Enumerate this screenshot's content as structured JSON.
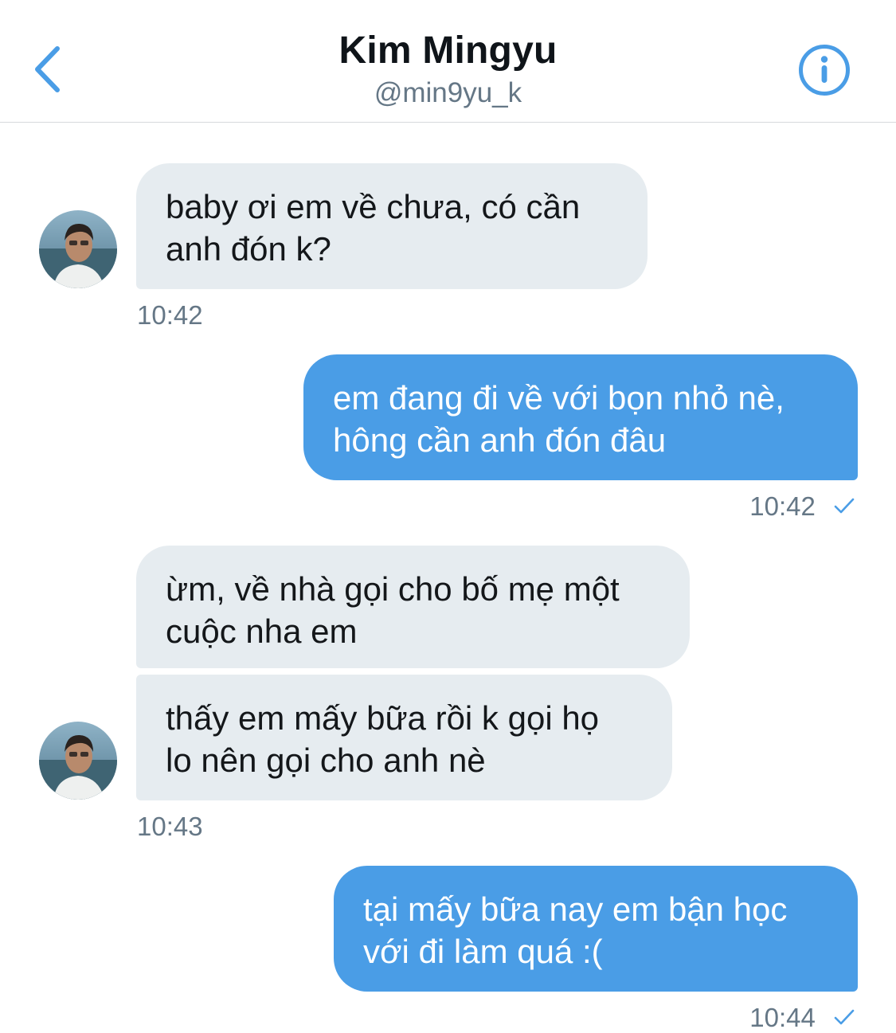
{
  "header": {
    "title": "Kim Mingyu",
    "handle": "@min9yu_k"
  },
  "colors": {
    "accent": "#4a9de6",
    "incoming_bubble": "#e6ecf0",
    "timestamp": "#657786"
  },
  "icons": {
    "back": "chevron-left-icon",
    "info": "info-circle-icon",
    "read": "checkmark-icon"
  },
  "messages": [
    {
      "direction": "incoming",
      "text": "baby ơi em về chưa, có cần\nanh đón k?"
    },
    {
      "direction": "outgoing",
      "text": "em đang đi về với bọn nhỏ nè,\nhông cần anh đón đâu"
    },
    {
      "direction": "incoming",
      "text": "ừm, về nhà gọi cho bố mẹ một\ncuộc nha em"
    },
    {
      "direction": "incoming",
      "text": "thấy em mấy bữa rồi k gọi họ\nlo nên gọi cho anh nè"
    },
    {
      "direction": "outgoing",
      "text": "tại mấy bữa nay em bận học\nvới đi làm quá :("
    }
  ],
  "timestamps": {
    "t1": "10:42",
    "t2": "10:42",
    "t3": "10:43",
    "t4": "10:44"
  }
}
